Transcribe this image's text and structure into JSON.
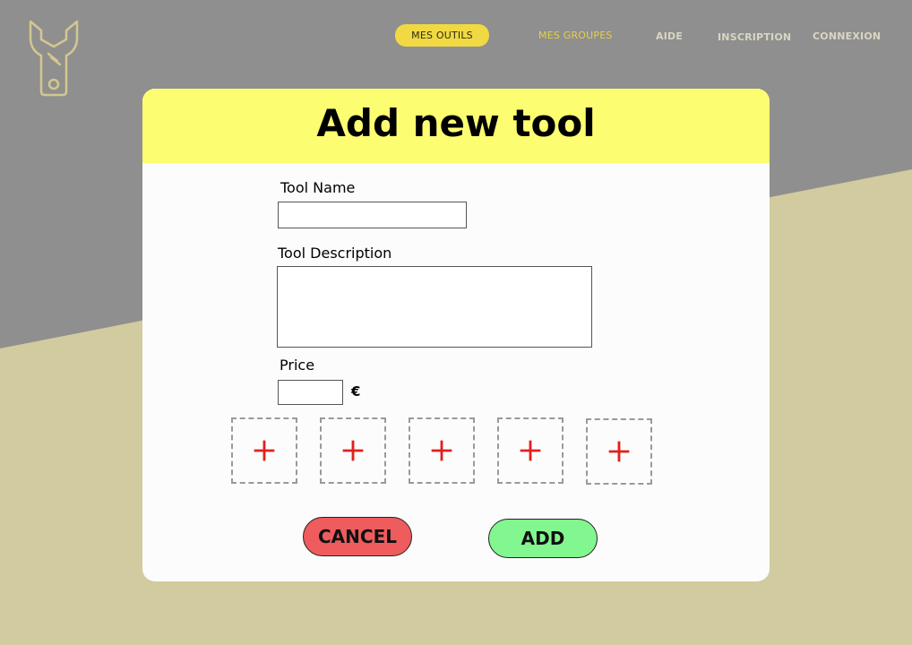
{
  "nav": {
    "items": [
      {
        "label": "MES OUTILS",
        "active": true
      },
      {
        "label": "MES GROUPES"
      },
      {
        "label": "AIDE"
      },
      {
        "label": "INSCRIPTION"
      },
      {
        "label": "CONNEXION"
      }
    ]
  },
  "logo": {
    "icon": "wrench-icon"
  },
  "modal": {
    "title": "Add new tool",
    "fields": {
      "name": {
        "label": "Tool Name",
        "value": ""
      },
      "description": {
        "label": "Tool Description",
        "value": ""
      },
      "price": {
        "label": "Price",
        "value": "",
        "currency": "€"
      }
    },
    "photo_slots": [
      "+",
      "+",
      "+",
      "+",
      "+"
    ],
    "actions": {
      "cancel_label": "CANCEL",
      "add_label": "ADD"
    }
  },
  "colors": {
    "background_gray": "#8f8f8f",
    "background_beige": "#d1cb9f",
    "header_yellow": "#fdfd72",
    "nav_active": "#f0d942",
    "cancel_red": "#ee5c5e",
    "add_green": "#82f78f",
    "plus_red": "#e0201e"
  }
}
